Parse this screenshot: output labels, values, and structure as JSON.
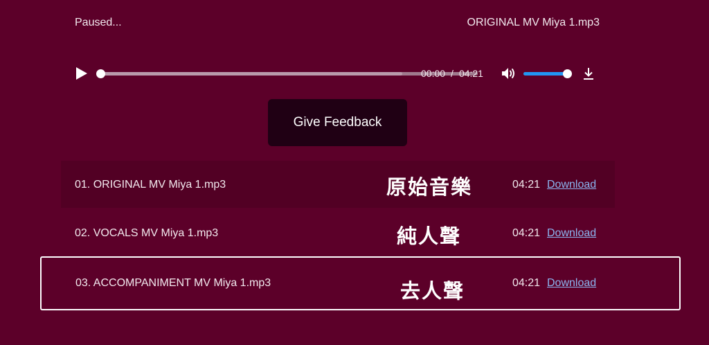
{
  "header": {
    "status": "Paused...",
    "current_track": "ORIGINAL MV Miya 1.mp3"
  },
  "player": {
    "current_time": "00:00",
    "separator": "/",
    "duration": "04:21",
    "progress_fraction": 0.0,
    "buffered_fraction": 0.8,
    "volume_fraction": 0.9,
    "icons": {
      "play": "play-icon",
      "volume": "volume-icon",
      "download": "download-icon"
    },
    "colors": {
      "volume_fill": "#2196f3",
      "background": "#5c0029"
    }
  },
  "feedback": {
    "label": "Give Feedback"
  },
  "playlist": [
    {
      "name": "01. ORIGINAL MV Miya 1.mp3",
      "cjk": "原始音樂",
      "duration": "04:21",
      "link": "Download",
      "state": "active"
    },
    {
      "name": "02. VOCALS MV Miya 1.mp3",
      "cjk": "純人聲",
      "duration": "04:21",
      "link": "Download",
      "state": "normal"
    },
    {
      "name": "03. ACCOMPANIMENT MV Miya 1.mp3",
      "cjk": "去人聲",
      "duration": "04:21",
      "link": "Download",
      "state": "selected"
    }
  ]
}
